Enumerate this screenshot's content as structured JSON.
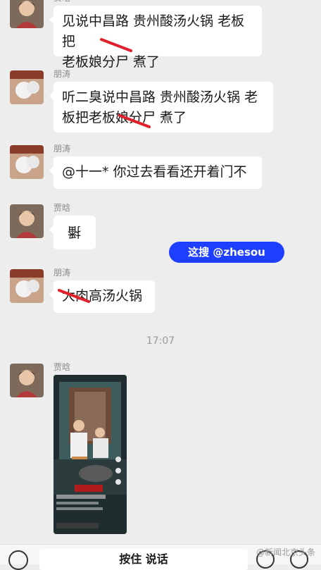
{
  "messages": [
    {
      "sender": "贾晗",
      "text": "见说中昌路 贵州酸汤火锅 老板把老板娘分尸 煮了"
    },
    {
      "sender": "朋涛",
      "text": "听二臭说中昌路 贵州酸汤火锅 老板把老板娘分尸 煮了"
    },
    {
      "sender": "朋涛",
      "text": "@十一* 你过去看看还开着门不"
    },
    {
      "sender": "贾晗",
      "text": "播"
    },
    {
      "sender": "朋涛",
      "text": "大肉高汤火锅"
    },
    {
      "sender": "贾晗",
      "type": "video"
    }
  ],
  "lines": {
    "m1a": "见说中昌路 贵州酸汤火锅 老板把",
    "m1b": "老板娘分尸 煮了",
    "m2a": "听二臭说中昌路 贵州酸汤火锅 老",
    "m2b": "板把老板娘分尸 煮了",
    "m3": "@十一* 你过去看看还开着门不",
    "m4": "播",
    "m5": "大肉高汤火锅"
  },
  "timestamp": "17:07",
  "watermark": "这搜 @zhesou",
  "bottom_bar": {
    "talk_label": "按住 说话",
    "weibo_text": "@新闻北京头条"
  },
  "colors": {
    "background": "#ededed",
    "bubble": "#ffffff",
    "strike": "#e0202a",
    "watermark": "#1e3fff"
  },
  "icons": [
    "voice-icon",
    "emoji-icon",
    "plus-icon"
  ]
}
